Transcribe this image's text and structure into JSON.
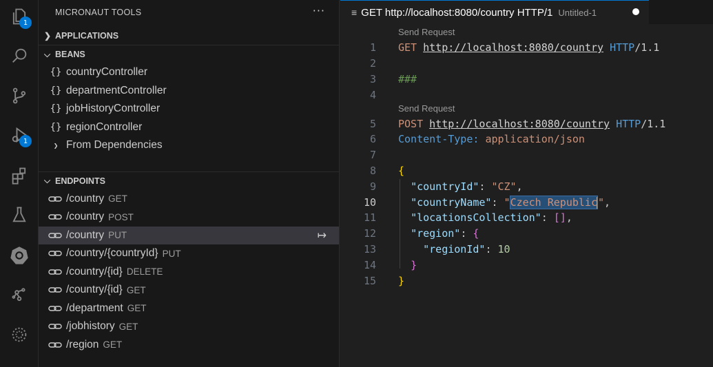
{
  "activity_bar": {
    "explorer_badge": "1",
    "debug_badge": "1"
  },
  "sidebar": {
    "title": "MICRONAUT TOOLS",
    "more": "···",
    "applications": "APPLICATIONS",
    "beans_header": "BEANS",
    "beans": [
      {
        "icon": "{}",
        "label": "countryController"
      },
      {
        "icon": "{}",
        "label": "departmentController"
      },
      {
        "icon": "{}",
        "label": "jobHistoryController"
      },
      {
        "icon": "{}",
        "label": "regionController"
      }
    ],
    "from_dependencies": "From Dependencies",
    "endpoints_header": "ENDPOINTS",
    "endpoints": [
      {
        "path": "/country",
        "method": "GET"
      },
      {
        "path": "/country",
        "method": "POST"
      },
      {
        "path": "/country",
        "method": "PUT"
      },
      {
        "path": "/country/{countryId}",
        "method": "PUT"
      },
      {
        "path": "/country/{id}",
        "method": "DELETE"
      },
      {
        "path": "/country/{id}",
        "method": "GET"
      },
      {
        "path": "/department",
        "method": "GET"
      },
      {
        "path": "/jobhistory",
        "method": "GET"
      },
      {
        "path": "/region",
        "method": "GET"
      }
    ],
    "goto_icon": "↦"
  },
  "editor": {
    "tab_icon": "≡",
    "tab_title": "GET http://localhost:8080/country HTTP/1",
    "tab_description": "Untitled-1",
    "codelens": "Send Request",
    "line_numbers": [
      "1",
      "2",
      "3",
      "4",
      "5",
      "6",
      "7",
      "8",
      "9",
      "10",
      "11",
      "12",
      "13",
      "14",
      "15"
    ],
    "code": {
      "l1_method": "GET",
      "l1_url": "http://localhost:8080/country",
      "l1_proto": "HTTP",
      "l1_ver": "/1.1",
      "l3": "###",
      "l5_method": "POST",
      "l5_url": "http://localhost:8080/country",
      "l5_proto": "HTTP",
      "l5_ver": "/1.1",
      "l6_name": "Content-Type:",
      "l6_value": "application/json",
      "l8": "{",
      "l9_key": "\"countryId\"",
      "l9_val": "\"CZ\"",
      "l10_key": "\"countryName\"",
      "l10_q1": "\"",
      "l10_sel": "Czech Republic",
      "l10_q2": "\"",
      "l11_key": "\"locationsCollection\"",
      "l11_val": "[]",
      "l12_key": "\"region\"",
      "l12_brace": "{",
      "l13_key": "\"regionId\"",
      "l13_val": "10",
      "l14": "}",
      "l15": "}"
    }
  }
}
